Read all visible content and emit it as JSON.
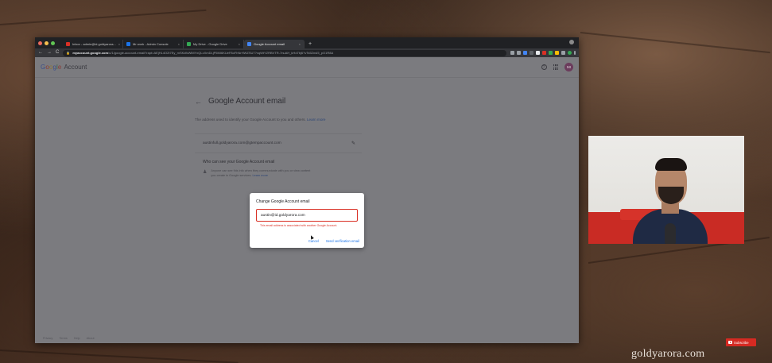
{
  "browser": {
    "tabs": [
      {
        "label": "Inbox - admin@id.goldyarora...",
        "favicon_color": "#d93025",
        "active": false
      },
      {
        "label": "Mr work - Admin Console",
        "favicon_color": "#1a73e8",
        "active": false
      },
      {
        "label": "My Drive - Google Drive",
        "favicon_color": "#34a853",
        "active": false
      },
      {
        "label": "Google Account email",
        "favicon_color": "#4285f4",
        "active": true
      }
    ],
    "new_tab": "+",
    "url_domain": "myaccount.google.com",
    "url_rest": "/u/1/google-account-email?rapt=AEjHL4O2t7Ey_mSKdfcWlMYxQLcXmDLjP5MI6KUeF8oFhNrHWZSU7?xqWtYZRBVTR-7nuAH_kHd7bj6?vTs5ZnsI5_pO1R8A",
    "nav_back": "←",
    "nav_forward": "→",
    "nav_reload": "C"
  },
  "header": {
    "logo_letters": [
      "G",
      "o",
      "o",
      "g",
      "l",
      "e"
    ],
    "product": "Account",
    "help_icon": "?",
    "avatar_initials": "MI"
  },
  "main": {
    "back_arrow": "←",
    "title": "Google Account email",
    "description": "The address used to identify your Google Account to you and others.",
    "learn_more": "Learn more",
    "current_email": "austinfull.goldyarora.com@gtempaccount.com",
    "edit_icon": "✎",
    "who_title": "Who can see your Google Account email",
    "who_text": "Anyone can see this info when they communicate with you or view content you create in Google services.",
    "who_learn_more": "Learn more"
  },
  "footer": {
    "links": [
      "Privacy",
      "Terms",
      "Help",
      "About"
    ]
  },
  "dialog": {
    "title": "Change Google Account email",
    "input_value": "austin@id.goldyarora.com",
    "error": "This email address is associated with another Google Account.",
    "cancel": "Cancel",
    "send": "Send verification email"
  },
  "overlay": {
    "subscribe": "Subscribe",
    "watermark": "goldyarora.com"
  },
  "colors": {
    "accent": "#1a73e8",
    "error": "#d93025",
    "subscribe": "#d62a22"
  }
}
